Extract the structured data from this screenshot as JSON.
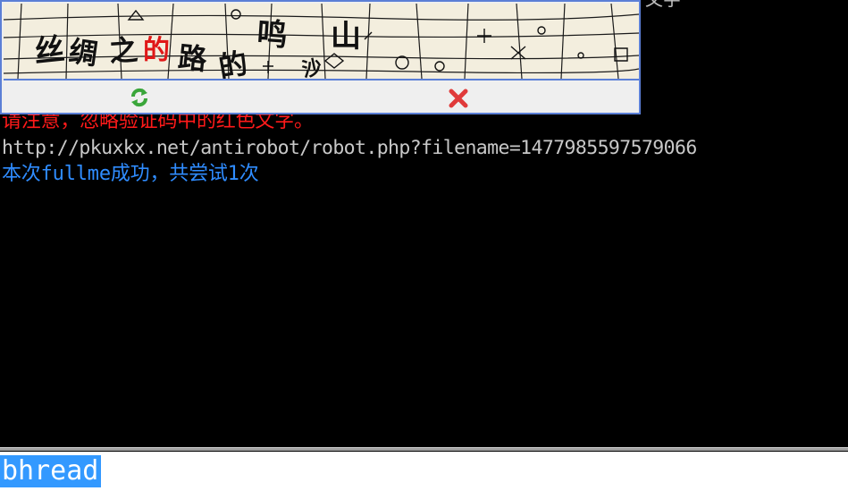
{
  "terminal": {
    "corner_text": "文字",
    "lines": [
      {
        "text": "请注意，忽略验证码中的红色文字。",
        "color": "#ff1a1a"
      },
      {
        "text": "http://pkuxkx.net/antirobot/robot.php?filename=1477985597579066",
        "color": "#c8c8c8"
      },
      {
        "text": "本次fullme成功，共尝试1次",
        "color": "#2f8cff"
      }
    ]
  },
  "captcha": {
    "border_color": "#5b7fd6",
    "background_color": "#f3eede",
    "image_chars": {
      "c1": "丝",
      "c2": "绸",
      "c3": "之",
      "c4": "的",
      "c5": "路",
      "c6": "的",
      "c7": "鸣",
      "c8": "山",
      "c9": "沙"
    },
    "red_char_color": "#e01818",
    "refresh_icon": "refresh-icon",
    "close_icon": "close-icon"
  },
  "command": {
    "value": "bhread",
    "selection_color": "#3399ff"
  }
}
